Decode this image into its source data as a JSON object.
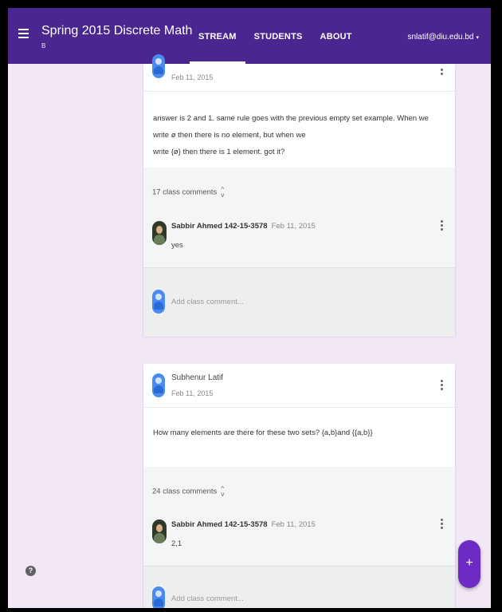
{
  "header": {
    "course_title": "Spring 2015 Discrete Math",
    "section": "B",
    "tabs": [
      {
        "label": "STREAM",
        "active": true
      },
      {
        "label": "STUDENTS",
        "active": false
      },
      {
        "label": "ABOUT",
        "active": false
      }
    ],
    "account": "snlatif@diu.edu.bd",
    "account_caret": "▾"
  },
  "posts": [
    {
      "author": "",
      "date": "Feb 11, 2015",
      "body_line1": "answer is 2 and 1. same rule goes with the previous empty set example. When we write ø then there is no element, but when we",
      "body_line2": "write {ø} then there is 1 element. got it?",
      "comment_count": "17 class comments",
      "comment": {
        "author": "Sabbir Ahmed 142-15-3578",
        "date": "Feb 11, 2015",
        "text": "yes"
      },
      "add_comment_placeholder": "Add class comment..."
    },
    {
      "author": "Subhenur Latif",
      "date": "Feb 11, 2015",
      "body_line1": "How many elements are there for these two sets? {a,b}and {{a,b}}",
      "comment_count": "24 class comments",
      "comment": {
        "author": "Sabbir Ahmed 142-15-3578",
        "date": "Feb 11, 2015",
        "text": "2,1"
      },
      "add_comment_placeholder": "Add class comment..."
    }
  ],
  "icons": {
    "menu": "menu-icon",
    "more": "more-vert-icon",
    "expand": "expand-collapse-icon",
    "help": "?",
    "fab": "+"
  },
  "colors": {
    "appbar": "#4a2790",
    "background": "#f1e7f5",
    "fab": "#6d2bc4",
    "avatar": "#4a8bf0"
  }
}
